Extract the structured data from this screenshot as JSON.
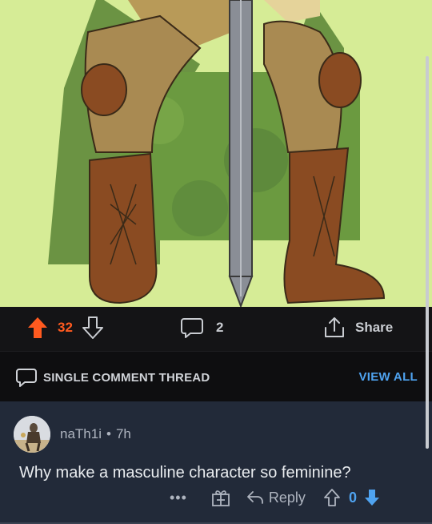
{
  "post_actions": {
    "upvote_count": "32",
    "comment_count": "2",
    "share_label": "Share"
  },
  "thread": {
    "label": "SINGLE COMMENT THREAD",
    "view_all_label": "VIEW ALL"
  },
  "comment": {
    "username": "naTh1i",
    "separator": "•",
    "time": "7h",
    "text": "Why make a masculine character so feminine?",
    "more_label": "•••",
    "reply_label": "Reply",
    "vote_count": "0"
  },
  "colors": {
    "upvote_active": "#ff5a1f",
    "link_blue": "#4fa3f0",
    "image_background": "#d6ec96"
  }
}
